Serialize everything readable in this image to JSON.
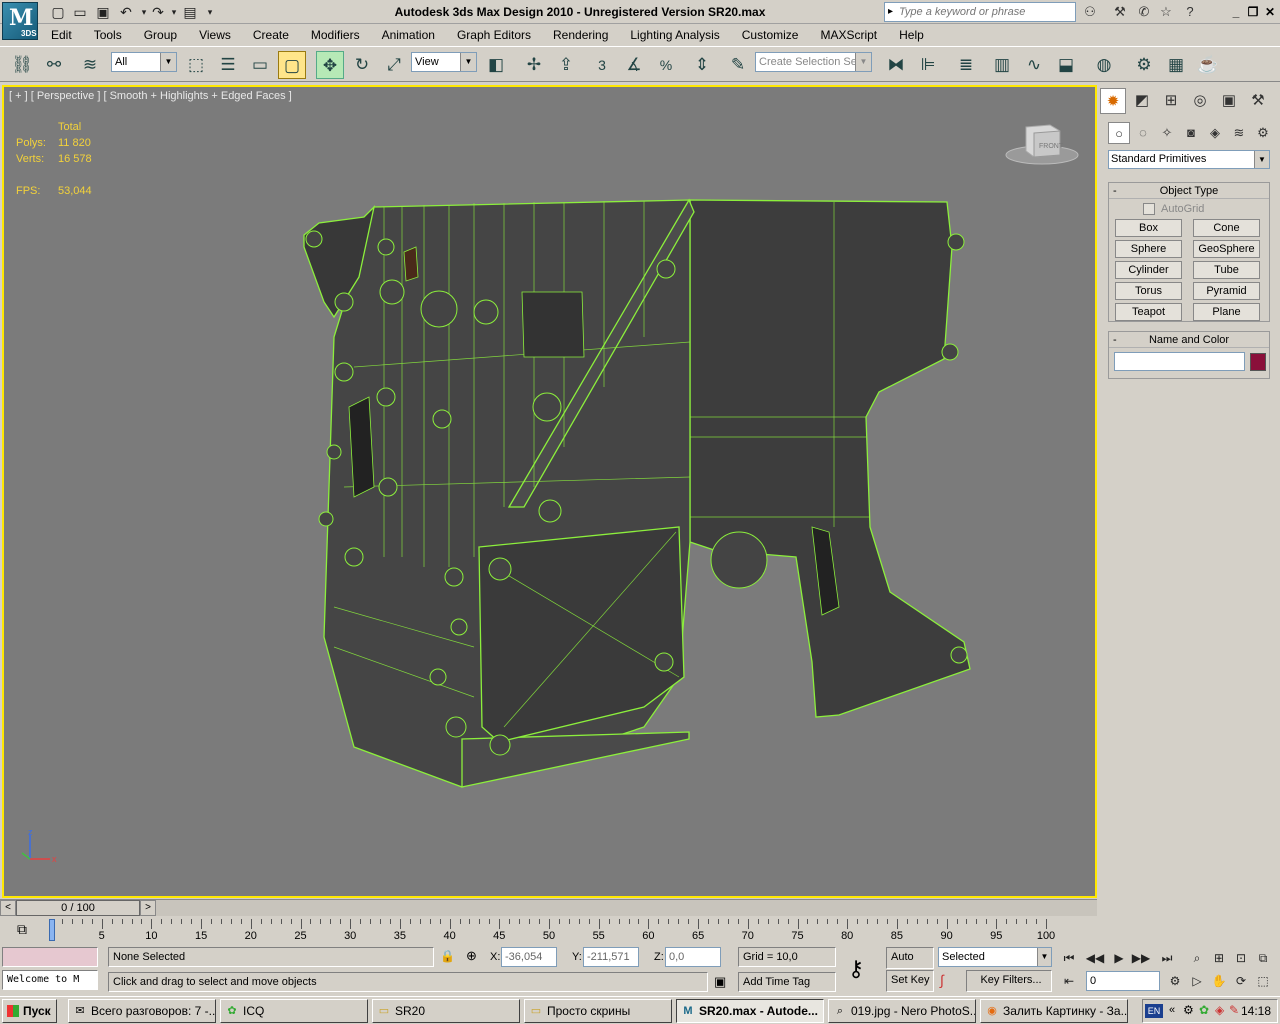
{
  "app": {
    "logo_text": "M",
    "logo_sub": "3DS",
    "title": "Autodesk 3ds Max Design 2010  - Unregistered Version      SR20.max",
    "search_placeholder": "Type a keyword or phrase"
  },
  "menu": [
    "Edit",
    "Tools",
    "Group",
    "Views",
    "Create",
    "Modifiers",
    "Animation",
    "Graph Editors",
    "Rendering",
    "Lighting Analysis",
    "Customize",
    "MAXScript",
    "Help"
  ],
  "toolbar": {
    "selection_filter": "All",
    "ref_coord": "View",
    "named_selection_placeholder": "Create Selection Se",
    "snap_label": "3",
    "percent_label": "%"
  },
  "viewport": {
    "label": "[ + ] [ Perspective ] [ Smooth + Highlights + Edged Faces ]",
    "stats": {
      "header": "Total",
      "polys_label": "Polys:",
      "polys": "11 820",
      "verts_label": "Verts:",
      "verts": "16 578",
      "fps_label": "FPS:",
      "fps": "53,044"
    },
    "viewcube_label": "FRONT",
    "axis_x": "x",
    "axis_z": "z",
    "wire_color": "#8cef3c",
    "bg_color": "#7b7b7b"
  },
  "command_panel": {
    "category": "Standard Primitives",
    "object_type_title": "Object Type",
    "autogrid_label": "AutoGrid",
    "primitives": [
      "Box",
      "Cone",
      "Sphere",
      "GeoSphere",
      "Cylinder",
      "Tube",
      "Torus",
      "Pyramid",
      "Teapot",
      "Plane"
    ],
    "name_color_title": "Name and Color",
    "name_value": "",
    "object_color": "#8a0f3a"
  },
  "timeline": {
    "position": "0 / 100",
    "current_frame": 0,
    "total_frames": 100,
    "tick_labels": [
      "0",
      "5",
      "10",
      "15",
      "20",
      "25",
      "30",
      "35",
      "40",
      "45",
      "50",
      "55",
      "60",
      "65",
      "70",
      "75",
      "80",
      "85",
      "90",
      "95",
      "100"
    ]
  },
  "status": {
    "selection": "None Selected",
    "prompt": "Click and drag to select and move objects",
    "maxscript": "Welcome to M",
    "x_label": "X:",
    "x": "-36,054",
    "y_label": "Y:",
    "y": "-211,571",
    "z_label": "Z:",
    "z": "0,0",
    "grid": "Grid = 10,0",
    "add_time_tag": "Add Time Tag",
    "auto_key": "Auto Key",
    "set_key": "Set Key",
    "key_mode": "Selected",
    "key_filters": "Key Filters...",
    "frame_value": "0"
  },
  "taskbar": {
    "start": "Пуск",
    "tasks": [
      {
        "label": "Всего разговоров: 7 -...",
        "active": false
      },
      {
        "label": "ICQ",
        "active": false
      },
      {
        "label": "SR20",
        "active": false
      },
      {
        "label": "Просто скрины",
        "active": false
      },
      {
        "label": "SR20.max - Autode...",
        "active": true
      },
      {
        "label": "019.jpg - Nero PhotoS...",
        "active": false
      },
      {
        "label": "Залить Картинку - За...",
        "active": false
      }
    ],
    "lang": "EN",
    "clock": "14:18"
  }
}
